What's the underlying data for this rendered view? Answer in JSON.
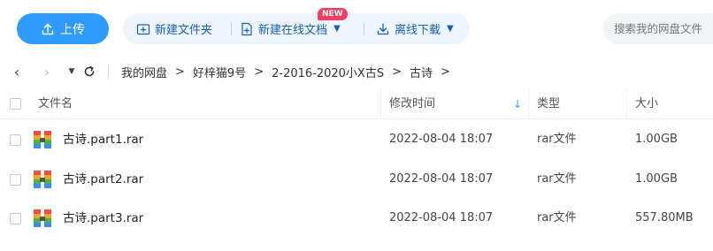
{
  "toolbar": {
    "upload_label": "上传",
    "new_folder_label": "新建文件夹",
    "new_online_doc_label": "新建在线文档",
    "new_badge": "NEW",
    "offline_download_label": "离线下载",
    "search_placeholder": "搜索我的网盘文件"
  },
  "navbar": {
    "breadcrumbs": [
      "我的网盘",
      "好梓猫9号",
      "2-2016-2020小X古S",
      "古诗"
    ],
    "separator": ">"
  },
  "table": {
    "columns": {
      "name": "文件名",
      "modified": "修改时间",
      "type": "类型",
      "size": "大小"
    },
    "rows": [
      {
        "name": "古诗.part1.rar",
        "modified": "2022-08-04 18:07",
        "type": "rar文件",
        "size": "1.00GB"
      },
      {
        "name": "古诗.part2.rar",
        "modified": "2022-08-04 18:07",
        "type": "rar文件",
        "size": "1.00GB"
      },
      {
        "name": "古诗.part3.rar",
        "modified": "2022-08-04 18:07",
        "type": "rar文件",
        "size": "557.80MB"
      }
    ]
  },
  "colors": {
    "accent": "#2f9bff",
    "action_text": "#1a5fb4",
    "badge": "#f53d61"
  }
}
